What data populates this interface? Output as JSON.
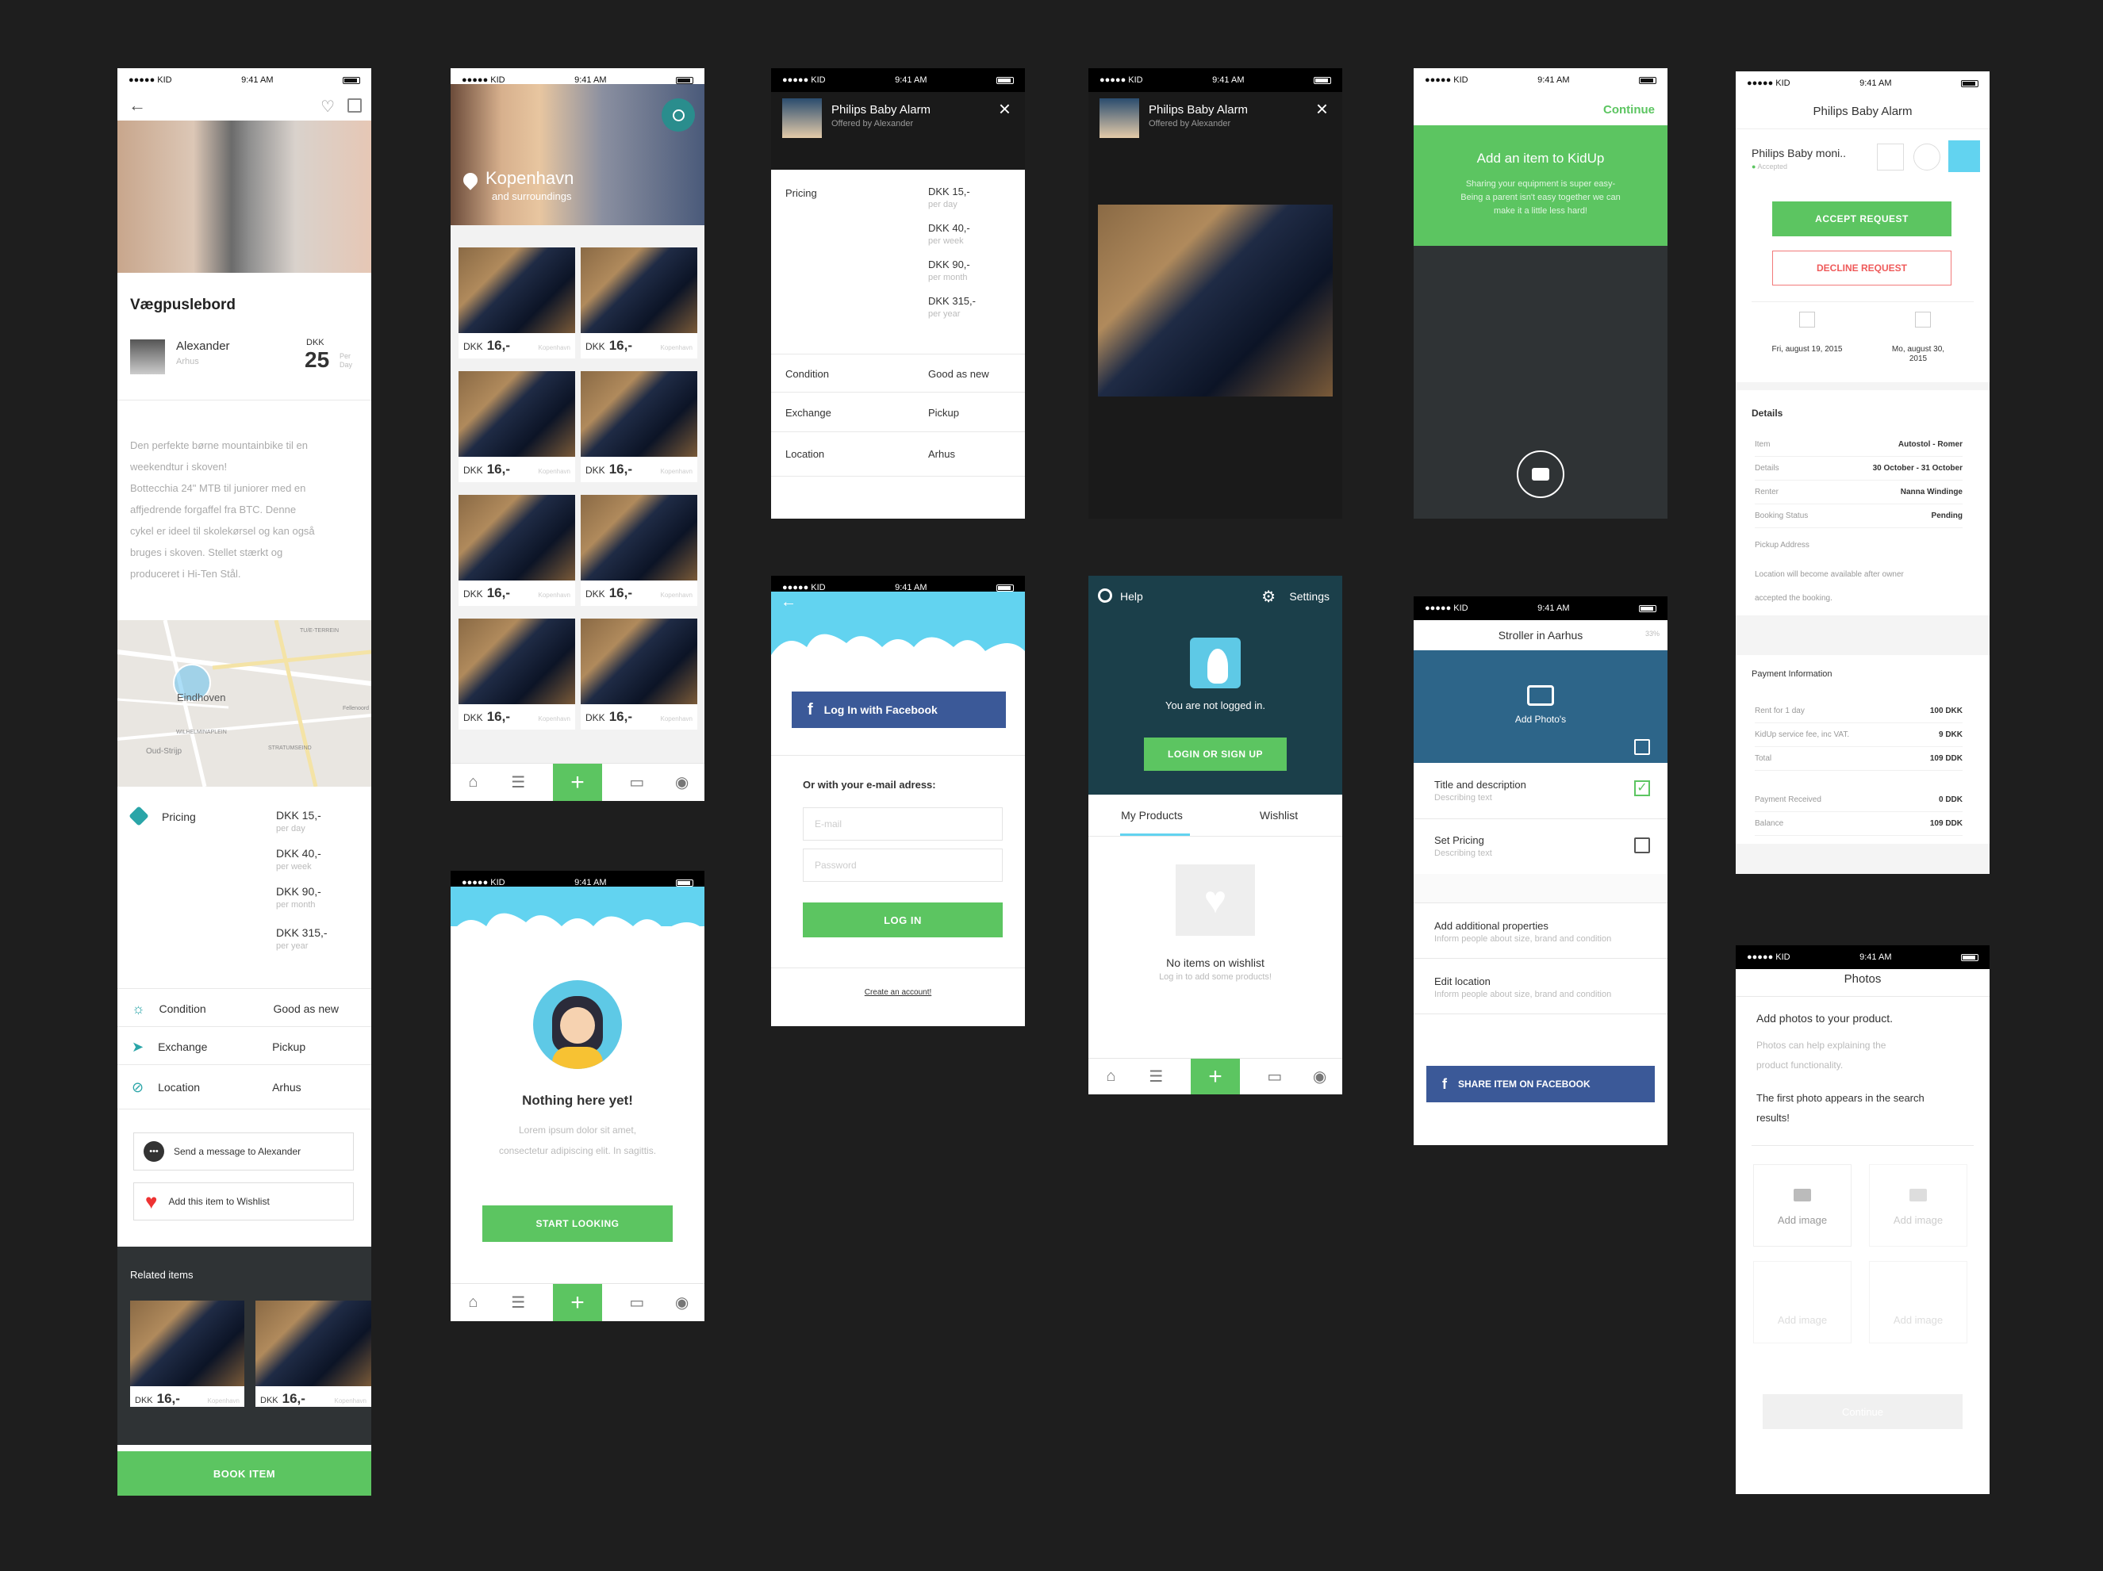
{
  "status": {
    "carrier": "●●●●● KID",
    "time": "9:41 AM"
  },
  "s1": {
    "title": "Vægpuslebord",
    "owner": "Alexander",
    "owner_city": "Arhus",
    "price_currency": "DKK",
    "price": "25",
    "price_unit_1": "Per",
    "price_unit_2": "Day",
    "desc_1": "Den perfekte børne mountainbike til en",
    "desc_2": "weekendtur i skoven!",
    "desc_3": "Bottecchia 24\" MTB til juniorer med en",
    "desc_4": "affjedrende forgaffel fra BTC. Denne",
    "desc_5": "cykel er ideel til skolekørsel og kan også",
    "desc_6": "bruges i skoven. Stellet stærkt og",
    "desc_7": "produceret i Hi-Ten Stål.",
    "map_city": "Eindhoven",
    "map_labels": [
      "Oud-Strijp",
      "WILHELMINAPLEIN",
      "Muziekgebouw Frits Philips",
      "Kazerne",
      "STRATUMSEIND",
      "Edhv",
      "TU/E-TERREIN",
      "Fellenoord",
      "Piet Hein"
    ],
    "pricing_label": "Pricing",
    "prices": [
      {
        "v": "DKK 15,-",
        "u": "per day"
      },
      {
        "v": "DKK 40,-",
        "u": "per week"
      },
      {
        "v": "DKK 90,-",
        "u": "per month"
      },
      {
        "v": "DKK 315,-",
        "u": "per year"
      }
    ],
    "condition_label": "Condition",
    "condition_value": "Good as new",
    "exchange_label": "Exchange",
    "exchange_value": "Pickup",
    "location_label": "Location",
    "location_value": "Arhus",
    "message_btn": "Send a message to Alexander",
    "wishlist_btn": "Add this item to Wishlist",
    "related_label": "Related items",
    "related": [
      {
        "cur": "DKK",
        "price": "16,-",
        "loc": "Kopenhavn"
      },
      {
        "cur": "DKK",
        "price": "16,-",
        "loc": "Kopenhavn"
      }
    ],
    "book_btn": "BOOK ITEM"
  },
  "s2": {
    "city": "Kopenhavn",
    "sub": "and surroundings",
    "tiles": [
      {
        "cur": "DKK",
        "price": "16,-",
        "loc": "Kopenhavn"
      },
      {
        "cur": "DKK",
        "price": "16,-",
        "loc": "Kopenhavn"
      },
      {
        "cur": "DKK",
        "price": "16,-",
        "loc": "Kopenhavn"
      },
      {
        "cur": "DKK",
        "price": "16,-",
        "loc": "Kopenhavn"
      },
      {
        "cur": "DKK",
        "price": "16,-",
        "loc": "Kopenhavn"
      },
      {
        "cur": "DKK",
        "price": "16,-",
        "loc": "Kopenhavn"
      },
      {
        "cur": "DKK",
        "price": "16,-",
        "loc": "Kopenhavn"
      },
      {
        "cur": "DKK",
        "price": "16,-",
        "loc": "Kopenhavn"
      }
    ]
  },
  "s3": {
    "title": "Philips Baby Alarm",
    "offered": "Offered by Alexander",
    "pricing_label": "Pricing",
    "prices": [
      {
        "v": "DKK 15,-",
        "u": "per day"
      },
      {
        "v": "DKK 40,-",
        "u": "per week"
      },
      {
        "v": "DKK 90,-",
        "u": "per month"
      },
      {
        "v": "DKK 315,-",
        "u": "per year"
      }
    ],
    "condition_label": "Condition",
    "condition_value": "Good as new",
    "exchange_label": "Exchange",
    "exchange_value": "Pickup",
    "location_label": "Location",
    "location_value": "Arhus"
  },
  "s4": {
    "title": "Philips Baby Alarm",
    "offered": "Offered by Alexander"
  },
  "s5": {
    "continue": "Continue",
    "title": "Add an item to KidUp",
    "sub_1": "Sharing your equipment is super easy-",
    "sub_2": "Being a parent isn't easy together we can",
    "sub_3": "make it a little less hard!"
  },
  "s6": {
    "title": "Philips Baby Alarm",
    "item": "Philips Baby moni..",
    "item_status": "Accepted",
    "accept": "ACCEPT REQUEST",
    "decline": "DECLINE REQUEST",
    "from_date": "Fri, august 19, 2015",
    "to_date_1": "Mo, august 30,",
    "to_date_2": "2015",
    "details_label": "Details",
    "details": [
      {
        "k": "Item",
        "v": "Autostol - Romer"
      },
      {
        "k": "Details",
        "v": "30 October - 31 October"
      },
      {
        "k": "Renter",
        "v": "Nanna Windinge"
      },
      {
        "k": "Booking Status",
        "v": "Pending"
      }
    ],
    "pickup_label": "Pickup Address",
    "pickup_note_1": "Location will become available after owner",
    "pickup_note_2": "accepted the booking.",
    "payment_label": "Payment Information",
    "payment": [
      {
        "k": "Rent for 1 day",
        "v": "100 DKK"
      },
      {
        "k": "KidUp service fee, inc VAT.",
        "v": "9 DKK"
      },
      {
        "k": "Total",
        "v": "109 DDK"
      }
    ],
    "payment2": [
      {
        "k": "Payment Received",
        "v": "0 DDK"
      },
      {
        "k": "Balance",
        "v": "109 DDK"
      }
    ]
  },
  "s7": {
    "fb_btn": "Log In with Facebook",
    "email_label": "Or with your e-mail adress:",
    "email_placeholder": "E-mail",
    "password_placeholder": "Password",
    "login_btn": "LOG IN",
    "create": "Create an account!"
  },
  "s8": {
    "help": "Help",
    "settings": "Settings",
    "not_logged": "You are not logged in.",
    "login_btn": "LOGIN OR SIGN UP",
    "tab1": "My Products",
    "tab2": "Wishlist",
    "empty_title": "No items on wishlist",
    "empty_sub": "Log in to add some products!"
  },
  "s9": {
    "title": "Stroller in Aarhus",
    "progress": "33%",
    "add_photo": "Add Photo's",
    "items": [
      {
        "t": "Title and description",
        "s": "Describing text",
        "checked": true
      },
      {
        "t": "Set Pricing",
        "s": "Describing text",
        "checked": false
      }
    ],
    "extra": [
      {
        "t": "Add additional properties",
        "s": "Inform people about size, brand and condition"
      },
      {
        "t": "Edit location",
        "s": "Inform people about size, brand and condition"
      }
    ],
    "share_btn": "SHARE ITEM ON FACEBOOK"
  },
  "s10": {
    "title": "Nothing here yet!",
    "sub_1": "Lorem ipsum dolor sit amet,",
    "sub_2": "consectetur adipiscing elit. In sagittis.",
    "btn": "START LOOKING"
  },
  "s11": {
    "title": "Photos",
    "heading": "Add photos to your product.",
    "help_1": "Photos can help explaining the",
    "help_2": "product functionality.",
    "note_1": "The first photo appears in the search",
    "note_2": "results!",
    "add": "Add image",
    "continue": "Continue"
  },
  "colors": {
    "green": "#5cc561",
    "teal": "#1b3f4a",
    "blue": "#3b5998",
    "steel": "#2d6589",
    "sky": "#62d3f0",
    "dark": "#2f3335"
  }
}
